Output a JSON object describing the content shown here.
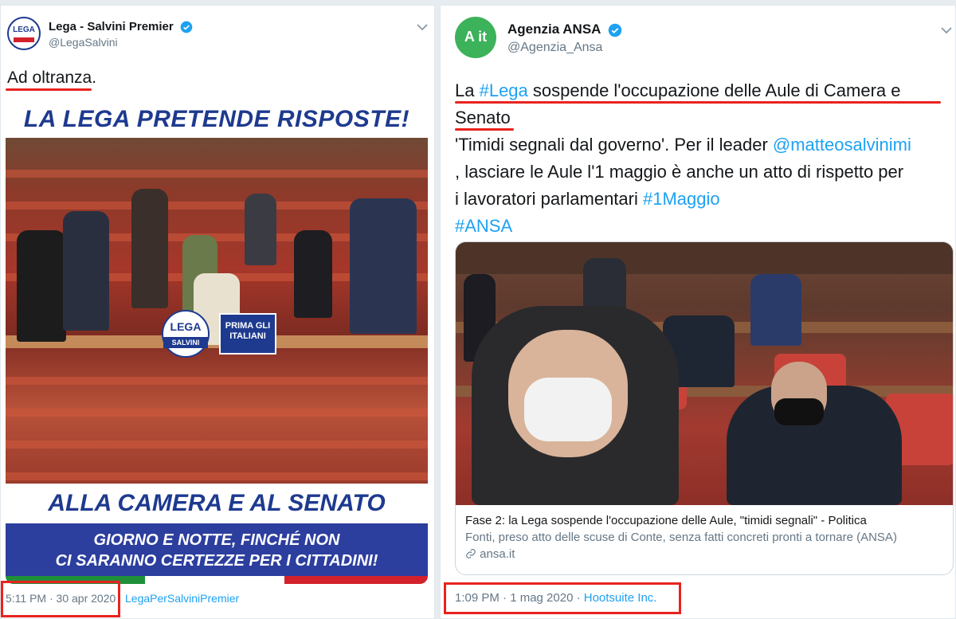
{
  "left": {
    "name": "Lega - Salvini Premier",
    "handle": "@LegaSalvini",
    "text": "Ad oltranza.",
    "poster": {
      "headline": "LA LEGA PRETENDE RISPOSTE!",
      "logo_text": "LEGA",
      "logo_sub": "SALVINI",
      "badge": "PRIMA GLI ITALIANI",
      "band_title": "ALLA CAMERA E AL SENATO",
      "band_line1": "GIORNO E NOTTE, FINCHÉ NON",
      "band_line2": "CI SARANNO CERTEZZE PER I CITTADINI!"
    },
    "timestamp": "5:11 PM · 30 apr 2020",
    "source": "LegaPerSalviniPremier",
    "avatar_text": "LEGA"
  },
  "right": {
    "name": "Agenzia ANSA",
    "handle": "@Agenzia_Ansa",
    "avatar_text": "A it",
    "line1_a": "La ",
    "hashtag_lega": "#Lega",
    "line1_b": " sospende l'occupazione delle Aule di Camera e",
    "line2": "Senato",
    "line3_a": "'Timidi segnali dal governo'. Per il leader ",
    "mention": "@matteosalvinimi",
    "line4": " , lasciare le Aule l'1 maggio è anche un atto di rispetto per",
    "line5_a": "i lavoratori parlamentari ",
    "hashtag_maggio": "#1Maggio",
    "hashtag_ansa": "#ANSA",
    "card": {
      "title": "Fase 2: la Lega sospende l'occupazione delle Aule, \"timidi segnali\" - Politica",
      "description": "Fonti, preso atto delle scuse di Conte, senza fatti concreti pronti a tornare (ANSA)",
      "domain": "ansa.it"
    },
    "timestamp": "1:09 PM · 1 mag 2020 · ",
    "source": "Hootsuite Inc."
  },
  "colors": {
    "accent": "#1da1f2",
    "highlight": "#e8231f",
    "lega_blue": "#1e3a8f"
  },
  "icons": [
    "verified-badge-icon",
    "chevron-down-icon",
    "link-icon"
  ]
}
